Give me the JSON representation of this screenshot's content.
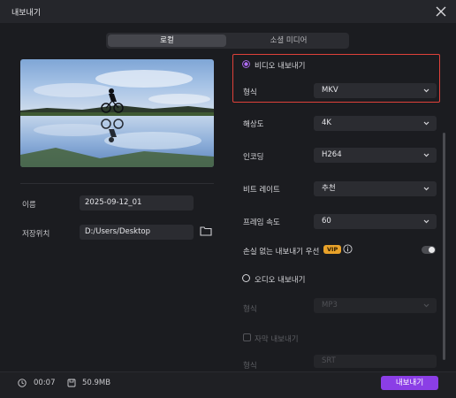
{
  "window": {
    "title": "내보내기"
  },
  "tabs": [
    {
      "label": "로컬"
    },
    {
      "label": "소셜 미디어"
    }
  ],
  "left": {
    "name_label": "이름",
    "name_value": "2025-09-12_01",
    "location_label": "저장위치",
    "location_value": "D:/Users/Desktop"
  },
  "right": {
    "video_export_label": "비디오 내보내기",
    "format_label": "형식",
    "format_value": "MKV",
    "resolution_label": "해상도",
    "resolution_value": "4K",
    "encoding_label": "인코딩",
    "encoding_value": "H264",
    "bitrate_label": "비트 레이트",
    "bitrate_value": "추천",
    "framerate_label": "프레임 속도",
    "framerate_value": "60",
    "lossless_label": "손실 없는 내보내기 우선",
    "vip_badge": "VIP",
    "audio_export_label": "오디오 내보내기",
    "audio_format_label": "형식",
    "audio_format_value": "MP3",
    "subtitle_export_label": "자막 내보내기",
    "subtitle_format_label": "형식",
    "subtitle_format_value": "SRT"
  },
  "footer": {
    "duration": "00:07",
    "file_size": "50.9MB",
    "export_button": "내보내기"
  },
  "colors": {
    "accent": "#8b3ee6",
    "highlight_border": "#e0413a",
    "vip": "#e9a22a",
    "background": "#1b1c20"
  }
}
